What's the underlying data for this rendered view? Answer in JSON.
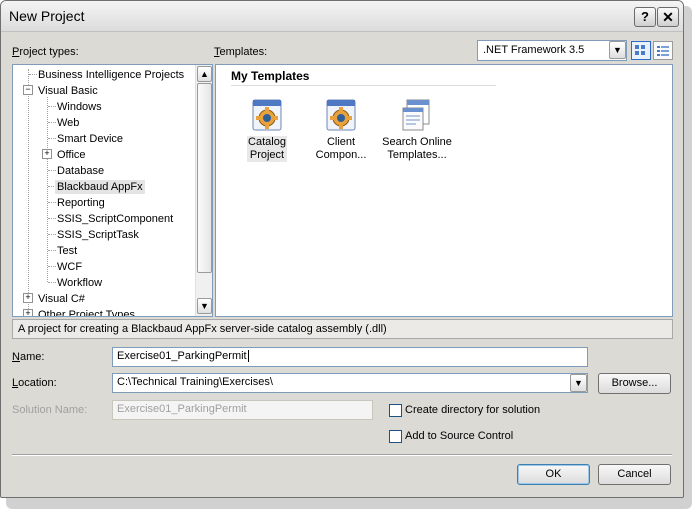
{
  "window": {
    "title": "New Project"
  },
  "labels": {
    "project_types": "Project types:",
    "templates": "Templates:",
    "name": "Name:",
    "location": "Location:",
    "solution_name": "Solution Name:"
  },
  "framework": {
    "selected": ".NET Framework 3.5"
  },
  "tree": {
    "items": [
      {
        "label": "Business Intelligence Projects"
      },
      {
        "label": "Visual Basic"
      },
      {
        "label": "Windows"
      },
      {
        "label": "Web"
      },
      {
        "label": "Smart Device"
      },
      {
        "label": "Office"
      },
      {
        "label": "Database"
      },
      {
        "label": "Blackbaud AppFx"
      },
      {
        "label": "Reporting"
      },
      {
        "label": "SSIS_ScriptComponent"
      },
      {
        "label": "SSIS_ScriptTask"
      },
      {
        "label": "Test"
      },
      {
        "label": "WCF"
      },
      {
        "label": "Workflow"
      },
      {
        "label": "Visual C#"
      },
      {
        "label": "Other Project Types"
      }
    ]
  },
  "templates": {
    "group": "My Templates",
    "items": [
      {
        "line1": "Catalog",
        "line2": "Project",
        "icon": "gear-project-icon"
      },
      {
        "line1": "Client",
        "line2": "Compon...",
        "icon": "gear-project-icon"
      },
      {
        "line1": "Search Online",
        "line2": "Templates...",
        "icon": "online-templates-icon"
      }
    ]
  },
  "description": "A project for creating a Blackbaud AppFx server-side catalog assembly (.dll)",
  "fields": {
    "name": "Exercise01_ParkingPermit",
    "location": "C:\\Technical Training\\Exercises\\",
    "solution_name": "Exercise01_ParkingPermit"
  },
  "checkboxes": {
    "create_directory": "Create directory for solution",
    "source_control": "Add to Source Control"
  },
  "buttons": {
    "browse": "Browse...",
    "ok": "OK",
    "cancel": "Cancel",
    "help": "?",
    "close": "✕"
  },
  "colors": {
    "selection": "#e4e4e4",
    "border": "#7f9db9",
    "accent": "#3c7fb1"
  }
}
